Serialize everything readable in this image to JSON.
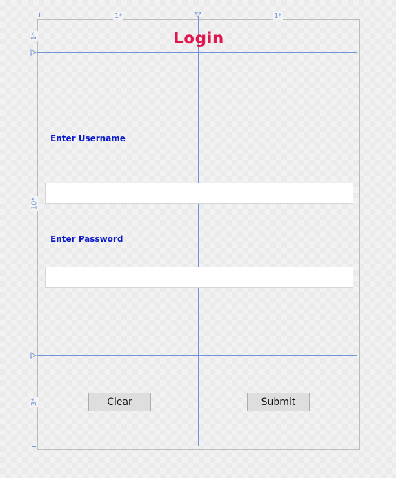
{
  "rulers": {
    "column_widths": [
      "1*",
      "1*"
    ],
    "row_heights": [
      "1*",
      "10*",
      "3*"
    ]
  },
  "form": {
    "title": "Login",
    "username_label": "Enter Username",
    "username_value": "",
    "password_label": "Enter Password",
    "password_value": "",
    "clear_label": "Clear",
    "submit_label": "Submit"
  },
  "colors": {
    "title": "#e0174d",
    "label": "#0b1ac8",
    "grid_line": "#6f95d8",
    "button_bg": "#dedede"
  }
}
